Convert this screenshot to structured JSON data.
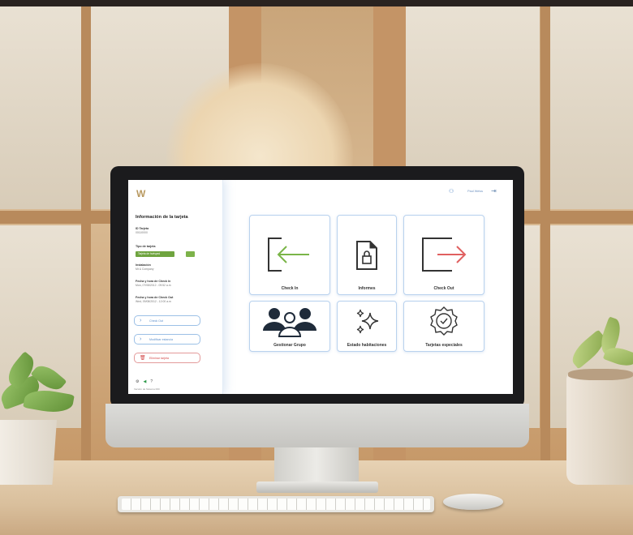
{
  "app": {
    "logo": "W",
    "user_name": "Paul Weiss"
  },
  "sidebar": {
    "title": "Información de la tarjeta",
    "id_label": "ID Tarjeta",
    "id_value": "00110000",
    "tipo_label": "Tipo de tarjeta",
    "tipo_value": "Tarjeta de huésped",
    "instalacion_label": "Instalación",
    "instalacion_value": "Mt & Company",
    "checkin_label": "Fecha y hora de Check In",
    "checkin_value": "Mon, 07/08/2012 - 09:52 a.m",
    "checkout_label": "Fecha y hora de Check Out",
    "checkout_value": "Wed, 09/08/2012 - 12:00 a.m",
    "buttons": [
      {
        "label": "Check Out"
      },
      {
        "label": "Modificar estancia"
      },
      {
        "label": "Eliminar tarjeta"
      }
    ],
    "version": "Versión de Sistema 000"
  },
  "tiles": [
    {
      "label": "Check In",
      "icon": "checkin-icon"
    },
    {
      "label": "Informes",
      "icon": "report-lock-icon"
    },
    {
      "label": "Check Out",
      "icon": "checkout-icon"
    },
    {
      "label": "Gestionar Grupo",
      "icon": "group-icon"
    },
    {
      "label": "Estado habitaciones",
      "icon": "sparkles-icon"
    },
    {
      "label": "Tarjetas especiales",
      "icon": "badge-check-icon"
    }
  ],
  "colors": {
    "accent_blue": "#5d8fca",
    "accent_green": "#6fa43f",
    "danger_red": "#d44a4a",
    "logo_gold": "#b89960"
  }
}
